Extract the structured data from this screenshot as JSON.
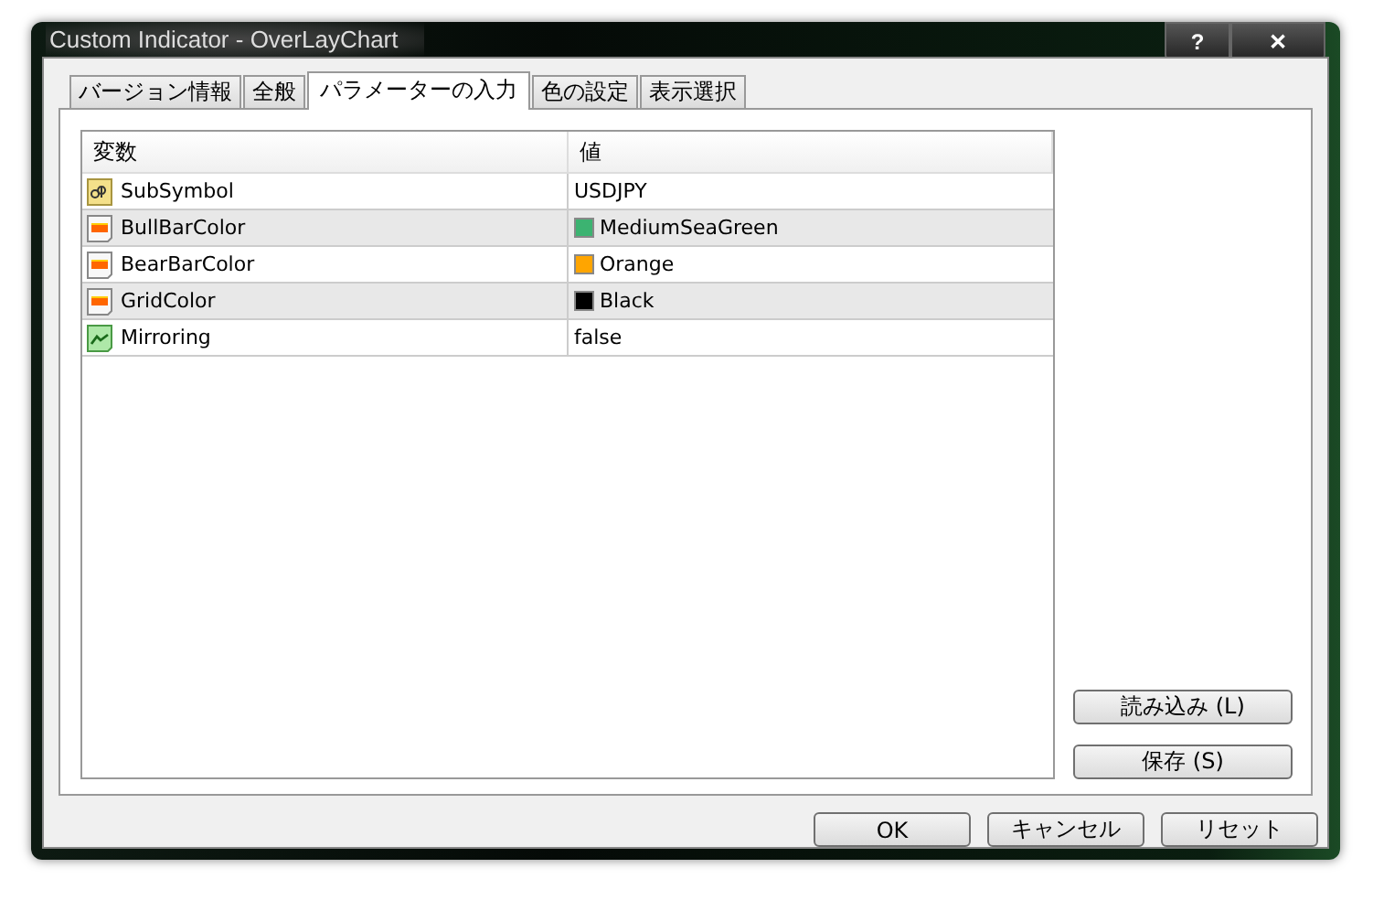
{
  "window": {
    "title": "Custom Indicator - OverLayChart",
    "help": "?",
    "close": "✕"
  },
  "tabs": [
    {
      "label": "バージョン情報",
      "selected": false
    },
    {
      "label": "全般",
      "selected": false
    },
    {
      "label": "パラメーターの入力",
      "selected": true
    },
    {
      "label": "色の設定",
      "selected": false
    },
    {
      "label": "表示選択",
      "selected": false
    }
  ],
  "table": {
    "columns": [
      "変数",
      "値"
    ],
    "rows": [
      {
        "kind": "text",
        "name": "SubSymbol",
        "value": "USDJPY"
      },
      {
        "kind": "color",
        "name": "BullBarColor",
        "value": "MediumSeaGreen",
        "color": "#3cb371"
      },
      {
        "kind": "color",
        "name": "BearBarColor",
        "value": "Orange",
        "color": "#ffa500"
      },
      {
        "kind": "color",
        "name": "GridColor",
        "value": "Black",
        "color": "#000000"
      },
      {
        "kind": "bool",
        "name": "Mirroring",
        "value": "false"
      }
    ]
  },
  "side_buttons": [
    "読み込み (L)",
    "保存 (S)"
  ],
  "buttons": [
    "OK",
    "キャンセル",
    "リセット"
  ]
}
